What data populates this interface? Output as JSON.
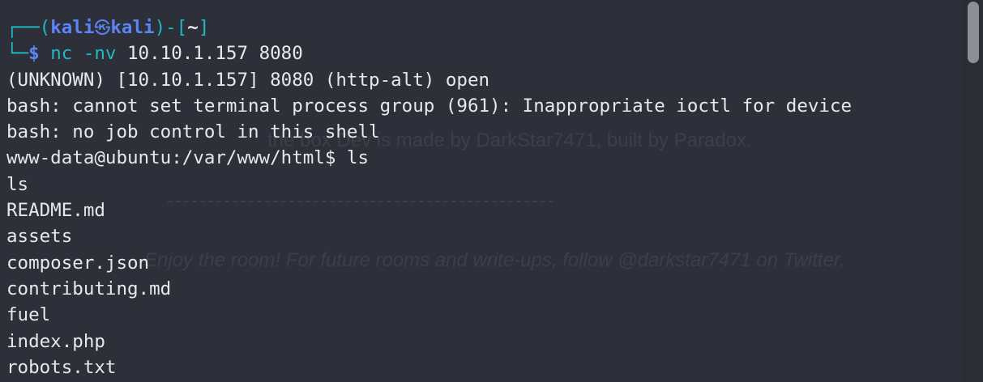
{
  "background_text": {
    "line1": "the box Dev is made by DarkStar7471, built by Paradox.",
    "line2": "Enjoy the room! For future rooms and write-ups, follow @darkstar7471 on Twitter."
  },
  "prompt": {
    "corner_top": "┌──",
    "open_paren": "(",
    "user": "kali",
    "separator_icon": "㉿",
    "host": "kali",
    "close_paren": ")-[",
    "cwd": "~",
    "close_bracket": "]",
    "corner_bottom": "└─",
    "dollar": "$",
    "command": "nc",
    "flag": "-nv",
    "args": "10.10.1.157 8080"
  },
  "output": [
    "(UNKNOWN) [10.10.1.157] 8080 (http-alt) open",
    "bash: cannot set terminal process group (961): Inappropriate ioctl for device",
    "bash: no job control in this shell",
    "www-data@ubuntu:/var/www/html$ ls",
    "ls",
    "README.md",
    "assets",
    "composer.json",
    "contributing.md",
    "fuel",
    "index.php",
    "robots.txt"
  ],
  "colors": {
    "background": "#2e3039",
    "prompt_frame": "#1fb8c4",
    "prompt_user": "#5b84f5",
    "text": "#e8e8ea"
  }
}
